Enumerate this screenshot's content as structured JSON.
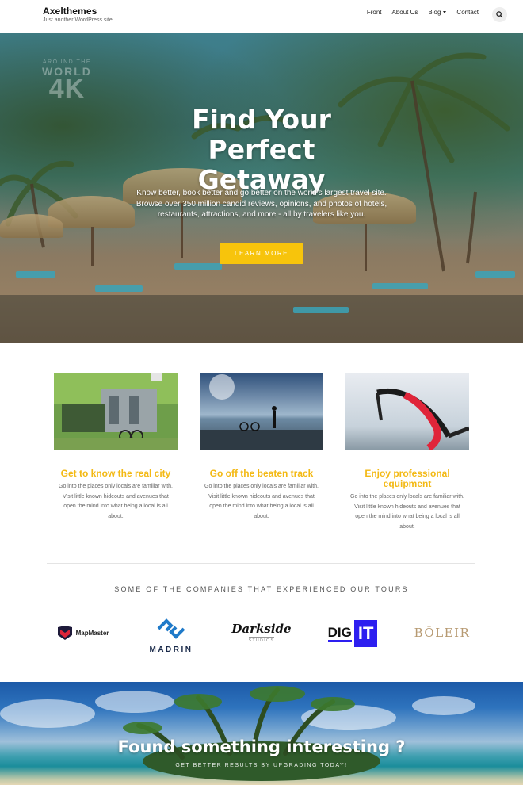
{
  "header": {
    "site_title": "Axelthemes",
    "tagline": "Just another WordPress site",
    "nav": [
      "Front",
      "About Us",
      "Blog",
      "Contact"
    ]
  },
  "hero": {
    "watermark_top": "AROUND THE",
    "watermark_mid": "WORLD",
    "watermark_big": "4K",
    "title": "Find Your Perfect Getaway",
    "text": "Know better, book better and go better on the world's largest travel site. Browse over 350 million candid reviews, opinions, and photos of hotels, restaurants, attractions, and more - all by travelers like you.",
    "button": "LEARN MORE"
  },
  "features": [
    {
      "title": "Get to know the real city",
      "text": "Go into the places only locals are familiar with. Visit little known hideouts and avenues that open the mind into what being a local is all about."
    },
    {
      "title": "Go off the beaten track",
      "text": "Go into the places only locals are familiar with. Visit little known hideouts and avenues that open the mind into what being a local is all about."
    },
    {
      "title": "Enjoy professional equipment",
      "text": "Go into the places only locals are familiar with. Visit little known hideouts and avenues that open the mind into what being a local is all about."
    }
  ],
  "companies": {
    "title": "SOME OF THE COMPANIES THAT EXPERIENCED OUR TOURS",
    "logos": {
      "mapmaster": "MapMaster",
      "madrin": "MADRIN",
      "darkside": "Darkside",
      "darkside_sub": "STUDIOS",
      "digit_a": "DIG",
      "digit_b": "IT",
      "boleir": "BŌLEIR"
    }
  },
  "cta": {
    "title": "Found something interesting ?",
    "subtitle": "GET BETTER RESULTS BY UPGRADING TODAY!"
  },
  "colors": {
    "accent": "#f7c40c",
    "feature_title": "#f3b914",
    "digit_blue": "#2d1ff0",
    "madrin_blue": "#1f7ac9",
    "boleir_gold": "#b79a72"
  },
  "icons": [
    "search-icon",
    "caret-down-icon"
  ]
}
